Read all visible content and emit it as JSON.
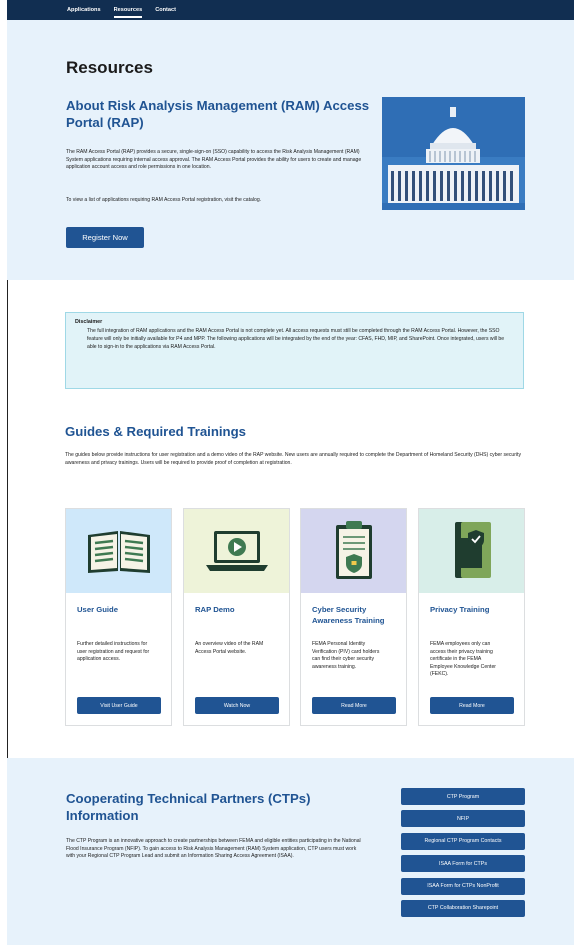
{
  "nav": {
    "items": [
      {
        "label": "Applications"
      },
      {
        "label": "Resources"
      },
      {
        "label": "Contact"
      }
    ]
  },
  "hero": {
    "title": "Resources",
    "subtitle": "About Risk Analysis Management (RAM) Access Portal (RAP)",
    "paragraph1": "The RAM Access Portal (RAP) provides a secure, single-sign-on (SSO) capability to access the Risk Analysis Management (RAM) System applications requiring internal access approval. The RAM Access Portal provides the ability for users to create and manage application account access and role permissions in one location.",
    "paragraph2": "To view a list of applications requiring RAM Access Portal registration, visit the catalog.",
    "register_label": "Register Now"
  },
  "disclaimer": {
    "title": "Disclaimer",
    "body": "The full integration of RAM applications and the RAM Access Portal is not complete yet. All access requests must still be completed through the RAM Access Portal. However, the SSO feature will only be initially available for P4 and MPP. The following applications will be integrated by the end of the year: CFAS, FHD, MIP, and SharePoint. Once integrated, users will be able to sign-in to the applications via RAM Access Portal."
  },
  "guides": {
    "title": "Guides & Required Trainings",
    "paragraph": "The guides below provide instructions for user registration and a demo video of the RAP website. New users are annually required to complete the Department of Homeland Security (DHS) cyber security awareness and privacy trainings. Users will be required to provide proof of completion at registration.",
    "cards": [
      {
        "title": "User Guide",
        "description": "Further detailed instructions for user registration and request for application access.",
        "button": "Visit User Guide",
        "icon": "book-icon",
        "bg": "#cfe8fa"
      },
      {
        "title": "RAP Demo",
        "description": "An overview video of the RAM Access Portal website.",
        "button": "Watch Now",
        "icon": "laptop-play-icon",
        "bg": "#eef3d9"
      },
      {
        "title": "Cyber Security Awareness Training",
        "description": "FEMA Personal Identity Verification (PIV) card holders can find their cyber security awareness training.",
        "button": "Read More",
        "icon": "clipboard-shield-icon",
        "bg": "#d4d6ef"
      },
      {
        "title": "Privacy Training",
        "description": "FEMA employees only can access their privacy training certificate in the FEMA Employee Knowledge Center (FEKC).",
        "button": "Read More",
        "icon": "shield-book-icon",
        "bg": "#d8eee9"
      }
    ]
  },
  "ctp": {
    "title": "Cooperating Technical Partners (CTPs) Information",
    "paragraph": "The CTP Program is an innovative approach to create partnerships between FEMA and eligible entities participating in the National Flood Insurance Program (NFIP). To gain access to Risk Analysis Management (RAM) System application, CTP users must work with your Regional CTP Program Lead and submit an Information Sharing Access Agreement (ISAA).",
    "buttons": [
      {
        "label": "CTP Program"
      },
      {
        "label": "NFIP"
      },
      {
        "label": "Regional CTP Program Contacts"
      },
      {
        "label": "ISAA Form for CTPs"
      },
      {
        "label": "ISAA Form for CTPs NonProfit"
      },
      {
        "label": "CTP Collaboration Sharepoint"
      }
    ]
  },
  "colors": {
    "nav_bg": "#112e51",
    "primary": "#205493",
    "hero_bg": "#e7f2fb",
    "disclaimer_bg": "#e1f3f8"
  }
}
